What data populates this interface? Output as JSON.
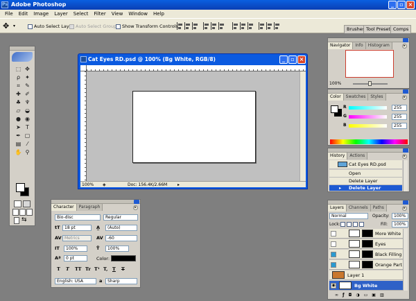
{
  "app": {
    "title": "Adobe Photoshop"
  },
  "menu": [
    "File",
    "Edit",
    "Image",
    "Layer",
    "Select",
    "Filter",
    "View",
    "Window",
    "Help"
  ],
  "options": {
    "auto_select_layer": "Auto Select Layer",
    "auto_select_groups": "Auto Select Groups",
    "show_transform_controls": "Show Transform Controls"
  },
  "palette_well": [
    "Brushes",
    "Tool Presets",
    "Comps"
  ],
  "document": {
    "title": "Cat Eyes RD.psd @ 100% (Bg White, RGB/8)",
    "zoom": "100%",
    "doc_size": "Doc: 156.4K/2.66M"
  },
  "navigator": {
    "tabs": [
      "Navigator",
      "Info",
      "Histogram"
    ],
    "zoom": "100%"
  },
  "color": {
    "tabs": [
      "Color",
      "Swatches",
      "Styles"
    ],
    "channels": [
      {
        "label": "R",
        "value": "255",
        "from": "#00ffff",
        "to": "#ffffff"
      },
      {
        "label": "G",
        "value": "255",
        "from": "#ff00ff",
        "to": "#ffffff"
      },
      {
        "label": "B",
        "value": "255",
        "from": "#ffff00",
        "to": "#ffffff"
      }
    ]
  },
  "history": {
    "tabs": [
      "History",
      "Actions"
    ],
    "snapshot": "Cat Eyes RD.psd",
    "items": [
      "Open",
      "Delete Layer",
      "Delete Layer"
    ],
    "selected_index": 2
  },
  "layers": {
    "tabs": [
      "Layers",
      "Channels",
      "Paths"
    ],
    "blend_mode": "Normal",
    "opacity_label": "Opacity:",
    "opacity": "100%",
    "lock_label": "Lock:",
    "fill_label": "Fill:",
    "fill": "100%",
    "items": [
      {
        "name": "More White",
        "thumb": "#000000"
      },
      {
        "name": "Eyes",
        "thumb": "#000000"
      },
      {
        "name": "Black Filling",
        "thumb": "#000000"
      },
      {
        "name": "Orange Part",
        "thumb": "#000000"
      },
      {
        "name": "Layer 1",
        "thumb": "#c9782e"
      },
      {
        "name": "Bg White",
        "thumb": "#ffffff"
      }
    ],
    "selected_index": 5
  },
  "character": {
    "tabs": [
      "Character",
      "Paragraph"
    ],
    "font_family": "Bio-disc",
    "font_style": "Regular",
    "font_size": "18 pt",
    "leading": "(Auto)",
    "kerning": "Metrics",
    "tracking": "-60",
    "vertical_scale": "100%",
    "horizontal_scale": "100%",
    "baseline_shift": "0 pt",
    "color_label": "Color:",
    "text_color": "#000000",
    "style_buttons": [
      "T",
      "T",
      "TT",
      "Tr",
      "T¹",
      "T,",
      "T",
      "T"
    ],
    "language": "English: USA",
    "aa_label": "a",
    "antialias": "Sharp"
  },
  "colors": {
    "accent": "#0a5fe0",
    "selection": "#2e61c7",
    "panel": "#d4d0c8",
    "workspace": "#7f7f7f"
  }
}
